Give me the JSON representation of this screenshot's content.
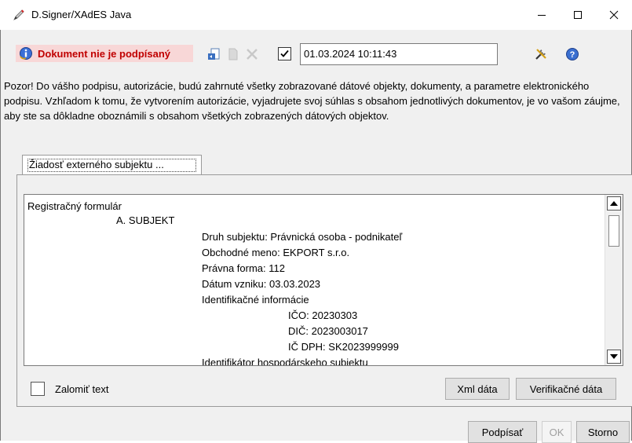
{
  "window": {
    "title": "D.Signer/XAdES Java"
  },
  "toolbar": {
    "status_text": "Dokument nie je podpísaný",
    "date_value": "01.03.2024 10:11:43",
    "date_checked": true
  },
  "notice": "Pozor! Do vášho podpisu, autorizácie, budú zahrnuté všetky zobrazované dátové objekty, dokumenty, a parametre elektronického podpisu. Vzhľadom k tomu, že vytvorením autorizácie, vyjadrujete svoj súhlas s obsahom jednotlivých dokumentov, je vo vašom záujme, aby ste sa dôkladne oboznámili s obsahom všetkých zobrazených dátových objektov.",
  "tab": {
    "label": "Žiadosť externého subjektu ..."
  },
  "document": {
    "lines": [
      "Registračný formulár",
      "A. SUBJEKT",
      "Druh subjektu: Právnická osoba - podnikateľ",
      "Obchodné meno: EKPORT s.r.o.",
      "Právna forma: 112",
      "Dátum vzniku: 03.03.2023",
      "Identifikačné informácie",
      "IČO: 20230303",
      "DIČ: 2023003017",
      "IČ DPH: SK2023999999",
      "Identifikátor hospodárskeho subjektu"
    ]
  },
  "options": {
    "wrap_label": "Zalomiť text",
    "wrap_checked": false
  },
  "buttons": {
    "xml": "Xml dáta",
    "verify": "Verifikačné dáta",
    "sign": "Podpísať",
    "ok": "OK",
    "cancel": "Storno"
  },
  "colors": {
    "status_bg": "#f8d7d7",
    "status_fg": "#c00000",
    "window_bg": "#f0f0f0"
  },
  "icons": [
    "pen-icon",
    "info-icon",
    "open-file-icon",
    "document-icon",
    "delete-icon",
    "tools-icon",
    "help-icon",
    "minimize-icon",
    "maximize-icon",
    "close-icon"
  ]
}
